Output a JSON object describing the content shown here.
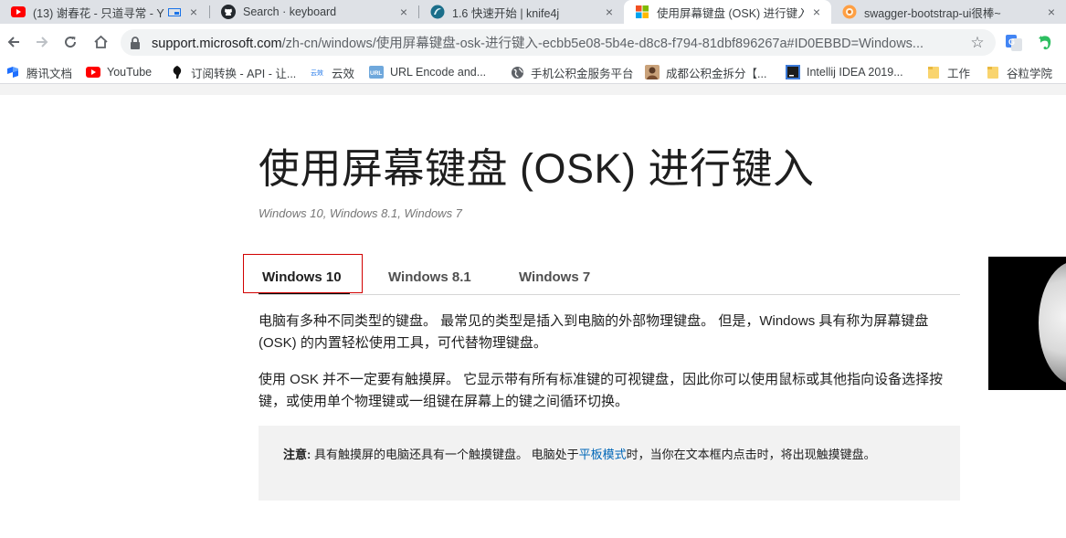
{
  "browser": {
    "tabs": [
      {
        "title": "(13) 谢春花 - 只道寻常 - Y",
        "icon": "youtube-icon",
        "active": false
      },
      {
        "title": "Search · keyboard",
        "icon": "github-icon",
        "active": false
      },
      {
        "title": "1.6 快速开始 | knife4j",
        "icon": "knife4j-icon",
        "active": false
      },
      {
        "title": "使用屏幕键盘 (OSK) 进行键入",
        "icon": "microsoft-icon",
        "active": true
      },
      {
        "title": "swagger-bootstrap-ui很棒~",
        "icon": "swagger-icon",
        "active": false
      }
    ],
    "close_glyph": "×",
    "url": {
      "host": "support.microsoft.com",
      "path": "/zh-cn/windows/使用屏幕键盘-osk-进行键入-ecbb5e08-5b4e-d8c8-f794-81dbf896267a#ID0EBBD=Windows..."
    },
    "bookmarks": [
      {
        "label": "腾讯文档",
        "icon": "tencent-docs-icon"
      },
      {
        "label": "YouTube",
        "icon": "youtube-icon"
      },
      {
        "label": "订阅转换 - API - 让...",
        "icon": "black-leaf-icon"
      },
      {
        "label": "云效",
        "icon": "yunxiao-icon"
      },
      {
        "label": "URL Encode and...",
        "icon": "url-encode-icon"
      },
      {
        "label": "手机公积金服务平台",
        "icon": "globe-icon"
      },
      {
        "label": "成都公积金拆分【...",
        "icon": "avatar-icon"
      },
      {
        "label": "Intellij IDEA 2019...",
        "icon": "idea-icon"
      },
      {
        "label": "工作",
        "icon": "folder-icon"
      },
      {
        "label": "谷粒学院",
        "icon": "folder-icon"
      }
    ],
    "colors": {
      "accent_blue": "#1a73e8",
      "highlight_red": "#d10000",
      "link": "#0067b8"
    }
  },
  "article": {
    "title": "使用屏幕键盘 (OSK) 进行键入",
    "applies_to": "Windows 10, Windows 8.1, Windows 7",
    "version_tabs": [
      {
        "label": "Windows 10",
        "selected": true
      },
      {
        "label": "Windows 8.1",
        "selected": false
      },
      {
        "label": "Windows 7",
        "selected": false
      }
    ],
    "paragraphs": [
      "电脑有多种不同类型的键盘。 最常见的类型是插入到电脑的外部物理键盘。 但是，Windows 具有称为屏幕键盘 (OSK) 的内置轻松使用工具，可代替物理键盘。",
      "使用 OSK 并不一定要有触摸屏。 它显示带有所有标准键的可视键盘，因此你可以使用鼠标或其他指向设备选择按键，或使用单个物理键或一组键在屏幕上的键之间循环切换。"
    ],
    "note": {
      "label": "注意:",
      "text_before": " 具有触摸屏的电脑还具有一个触摸键盘。 电脑处于",
      "link": "平板模式",
      "text_after": "时，当你在文本框内点击时，将出现触摸键盘。"
    }
  }
}
